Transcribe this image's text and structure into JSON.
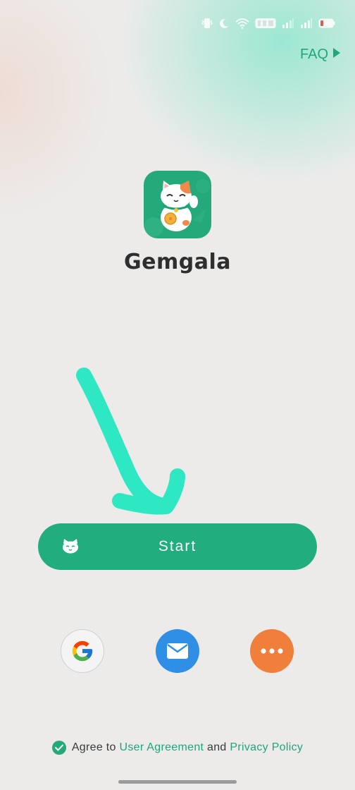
{
  "faq": {
    "label": "FAQ",
    "icon": "play-triangle-icon"
  },
  "app": {
    "name": "Gemgala",
    "logo_icon": "lucky-cat-logo"
  },
  "start_button": {
    "label": "Start",
    "icon": "cat-face-icon"
  },
  "login_options": [
    {
      "name": "google",
      "icon": "google-icon"
    },
    {
      "name": "email",
      "icon": "mail-icon"
    },
    {
      "name": "more",
      "icon": "more-dots-icon"
    }
  ],
  "agreement": {
    "prefix": "Agree to",
    "user_agreement": "User Agreement",
    "and": "and",
    "privacy_policy": "Privacy Policy",
    "checked": true
  },
  "status_bar": {
    "icons": [
      "vibrate-icon",
      "do-not-disturb-moon-icon",
      "wifi-icon",
      "hd-icon",
      "signal-icon",
      "signal-icon",
      "battery-icon"
    ]
  },
  "colors": {
    "brand_green": "#22ad7e",
    "email_blue": "#2f8fe6",
    "more_orange": "#f07f3c",
    "annotation_arrow": "#2ee8c4"
  }
}
